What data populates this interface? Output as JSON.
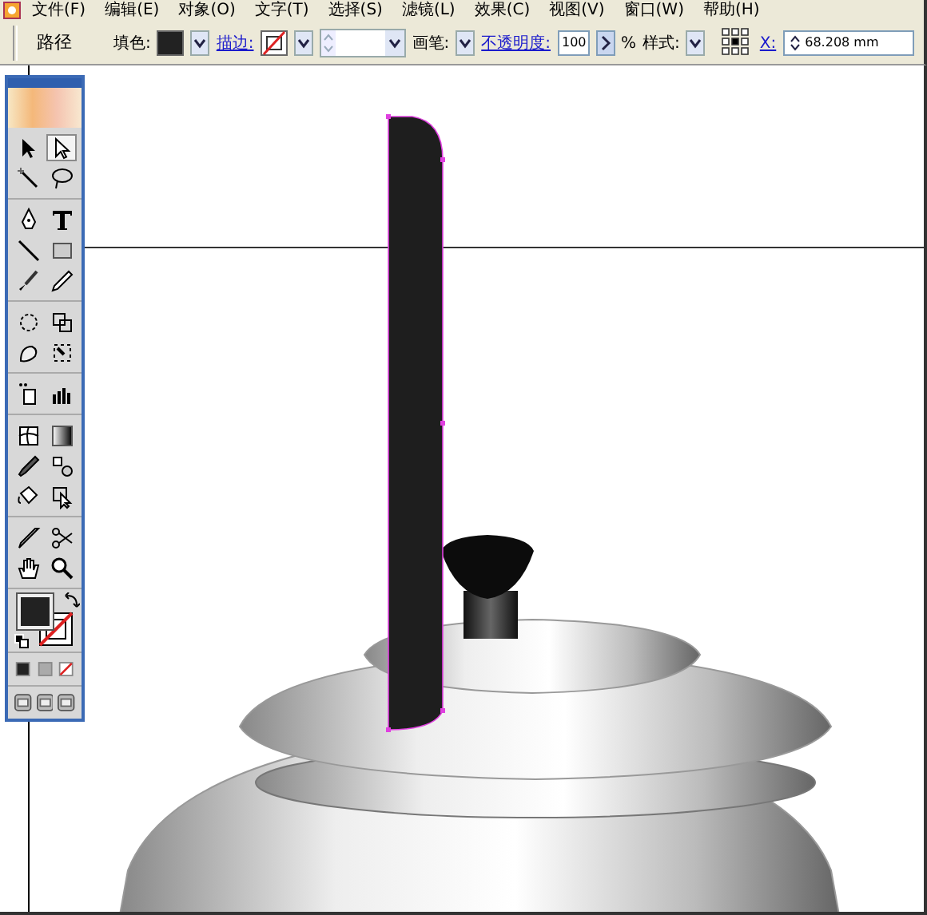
{
  "menu": [
    "文件(F)",
    "编辑(E)",
    "对象(O)",
    "文字(T)",
    "选择(S)",
    "滤镜(L)",
    "效果(C)",
    "视图(V)",
    "窗口(W)",
    "帮助(H)"
  ],
  "control_bar": [
    {
      "kind": "title",
      "text": "路径"
    },
    {
      "kind": "label",
      "text": "填色:"
    },
    {
      "kind": "fill-swatch"
    },
    {
      "kind": "dropdown"
    },
    {
      "kind": "link",
      "text": "描边:"
    },
    {
      "kind": "none-swatch"
    },
    {
      "kind": "dropdown"
    },
    {
      "kind": "weight-field"
    },
    {
      "kind": "label",
      "text": "画笔:"
    },
    {
      "kind": "dropdown"
    },
    {
      "kind": "link",
      "text": "不透明度:"
    },
    {
      "kind": "field",
      "value": "100"
    },
    {
      "kind": "arrow-button"
    },
    {
      "kind": "label",
      "text": "%"
    },
    {
      "kind": "label",
      "text": "样式:"
    },
    {
      "kind": "dropdown"
    },
    {
      "kind": "reference-point"
    },
    {
      "kind": "link",
      "text": "X:"
    },
    {
      "kind": "spin-field",
      "value": "68.208 mm"
    }
  ],
  "toolbox": {
    "groups": [
      [
        {
          "kind": "selection",
          "selected": false
        },
        {
          "kind": "direct-selection",
          "selected": true
        },
        {
          "kind": "magic-wand",
          "selected": false
        },
        {
          "kind": "lasso",
          "selected": false
        }
      ],
      [
        {
          "kind": "pen",
          "selected": false
        },
        {
          "kind": "type",
          "selected": false
        },
        {
          "kind": "line",
          "selected": false
        },
        {
          "kind": "rectangle",
          "selected": false
        },
        {
          "kind": "paintbrush",
          "selected": false
        },
        {
          "kind": "pencil",
          "selected": false
        }
      ],
      [
        {
          "kind": "rotate",
          "selected": false
        },
        {
          "kind": "scale",
          "selected": false
        },
        {
          "kind": "warp",
          "selected": false
        },
        {
          "kind": "free-transform",
          "selected": false
        }
      ],
      [
        {
          "kind": "symbol-sprayer",
          "selected": false
        },
        {
          "kind": "graph",
          "selected": false
        }
      ],
      [
        {
          "kind": "mesh",
          "selected": false
        },
        {
          "kind": "gradient",
          "selected": false
        },
        {
          "kind": "eyedropper",
          "selected": false
        },
        {
          "kind": "blend",
          "selected": false
        },
        {
          "kind": "paint-bucket",
          "selected": false
        },
        {
          "kind": "paint-select",
          "selected": false
        }
      ],
      [
        {
          "kind": "knife",
          "selected": false
        },
        {
          "kind": "scissors",
          "selected": false
        },
        {
          "kind": "hand",
          "selected": false
        },
        {
          "kind": "zoom",
          "selected": false
        }
      ]
    ]
  }
}
